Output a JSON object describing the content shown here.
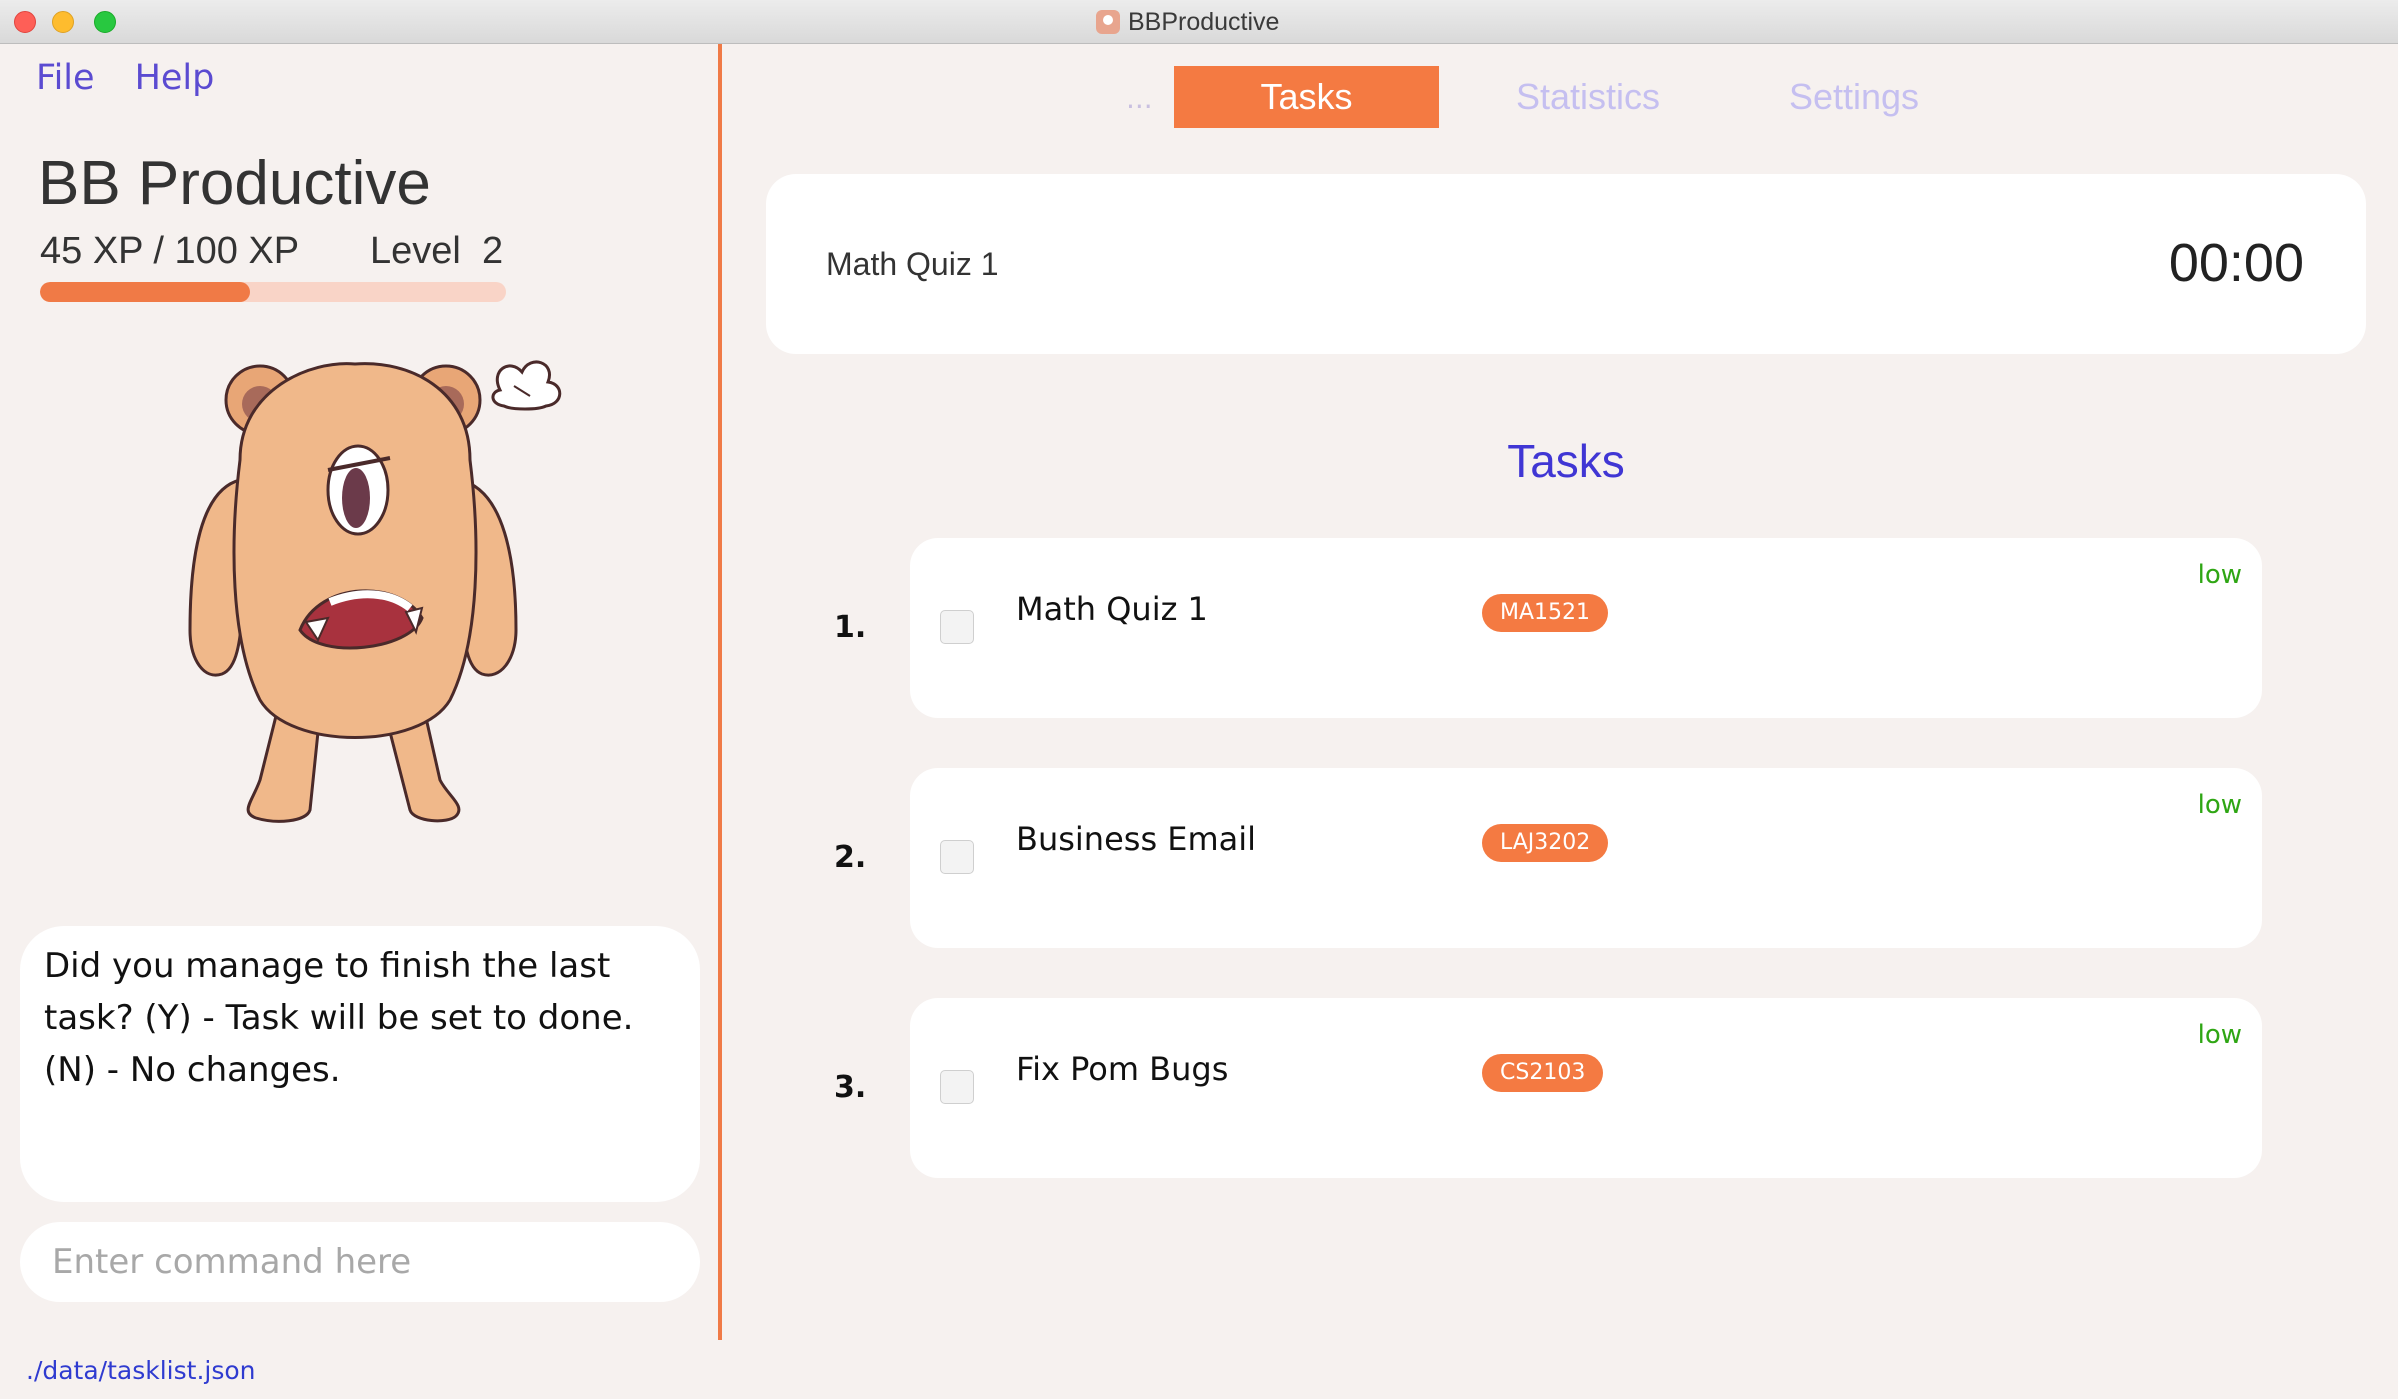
{
  "window": {
    "title": "BBProductive"
  },
  "menu": {
    "file": "File",
    "help": "Help"
  },
  "profile": {
    "app_name": "BB Productive",
    "xp_text": "45 XP / 100 XP",
    "level_label": "Level",
    "level_value": "2",
    "xp_current": 45,
    "xp_max": 100
  },
  "speech": {
    "text": "Did you manage to finish the last task? (Y) - Task will be set to done. (N) - No changes."
  },
  "command": {
    "placeholder": "Enter command here",
    "value": ""
  },
  "status": {
    "path": "./data/tasklist.json"
  },
  "tabs": {
    "ellipsis": "...",
    "tasks": "Tasks",
    "statistics": "Statistics",
    "settings": "Settings"
  },
  "timer": {
    "task": "Math Quiz 1",
    "time": "00:00"
  },
  "tasks": {
    "heading": "Tasks",
    "items": [
      {
        "index": "1.",
        "name": "Math Quiz 1",
        "tag": "MA1521",
        "priority": "low"
      },
      {
        "index": "2.",
        "name": "Business Email",
        "tag": "LAJ3202",
        "priority": "low"
      },
      {
        "index": "3.",
        "name": "Fix Pom Bugs",
        "tag": "CS2103",
        "priority": "low"
      }
    ]
  },
  "colors": {
    "accent": "#f47a42",
    "heading": "#4036d4",
    "menu": "#5b4bd1",
    "priority_low": "#2fa614",
    "background": "#f6f1ef"
  },
  "icons": {
    "mascot": "angry-monster-mascot-icon",
    "app": "app-icon"
  }
}
